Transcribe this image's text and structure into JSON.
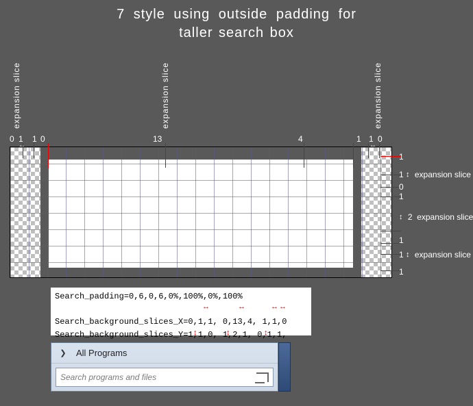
{
  "title": {
    "line1": "7 style  using  outside  padding  for",
    "line2": "taller search box"
  },
  "vertical_labels": {
    "left": "expansion slice",
    "mid": "expansion slice",
    "right": "expansion slice"
  },
  "top_numbers": {
    "n0a": "0",
    "n1a": "1",
    "n1b": "1",
    "n0b": "0",
    "n13": "13",
    "n4": "4",
    "nr1a": "1",
    "nr1b": "1",
    "nr0": "0"
  },
  "right_labels": {
    "r1a": "1",
    "r1b_text": "expansion slice",
    "r1b_num": "1",
    "r0": "0",
    "r1c": "1",
    "r2_num": "2",
    "r2_text": "expansion slice",
    "r1d": "1",
    "r1e_num": "1",
    "r1e_text": "expansion slice",
    "r1f": "1"
  },
  "code": {
    "line1": "Search_padding=0,6,0,6,0%,100%,0%,100%",
    "line2": "Search_background_slices_X=0,1,1, 0,13,4, 1,1,0",
    "line3": "Search_background_slices_Y=1,1,0, 1,2,1, 0,1,1,"
  },
  "menu": {
    "all_programs": "All Programs",
    "search_placeholder": "Search programs and files"
  }
}
